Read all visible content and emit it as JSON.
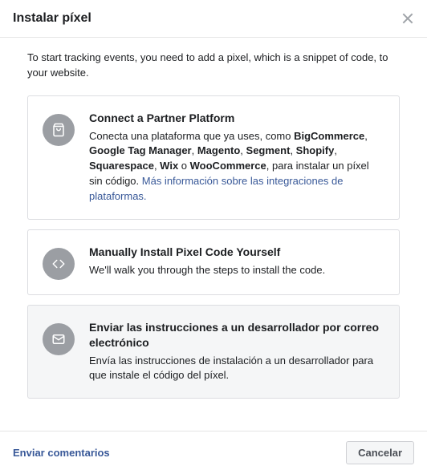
{
  "header": {
    "title": "Instalar píxel"
  },
  "intro": "To start tracking events, you need to add a pixel, which is a snippet of code, to your website.",
  "options": {
    "partner": {
      "title": "Connect a Partner Platform",
      "desc_pre": "Conecta una plataforma que ya uses, como ",
      "b1": "BigCommerce",
      "b2": "Google Tag Manager",
      "b3": "Magento",
      "b4": "Segment",
      "b5": "Shopify",
      "b6": "Squarespace",
      "b7": "Wix",
      "b8": "WooCommerce",
      "desc_mid": ", para instalar un píxel sin código. ",
      "link": "Más información sobre las integraciones de plataformas."
    },
    "manual": {
      "title": "Manually Install Pixel Code Yourself",
      "desc": "We'll walk you through the steps to install the code."
    },
    "email": {
      "title": "Enviar las instrucciones a un desarrollador por correo electrónico",
      "desc": "Envía las instrucciones de instalación a un desarrollador para que instale el código del píxel."
    }
  },
  "footer": {
    "feedback": "Enviar comentarios",
    "cancel": "Cancelar"
  }
}
